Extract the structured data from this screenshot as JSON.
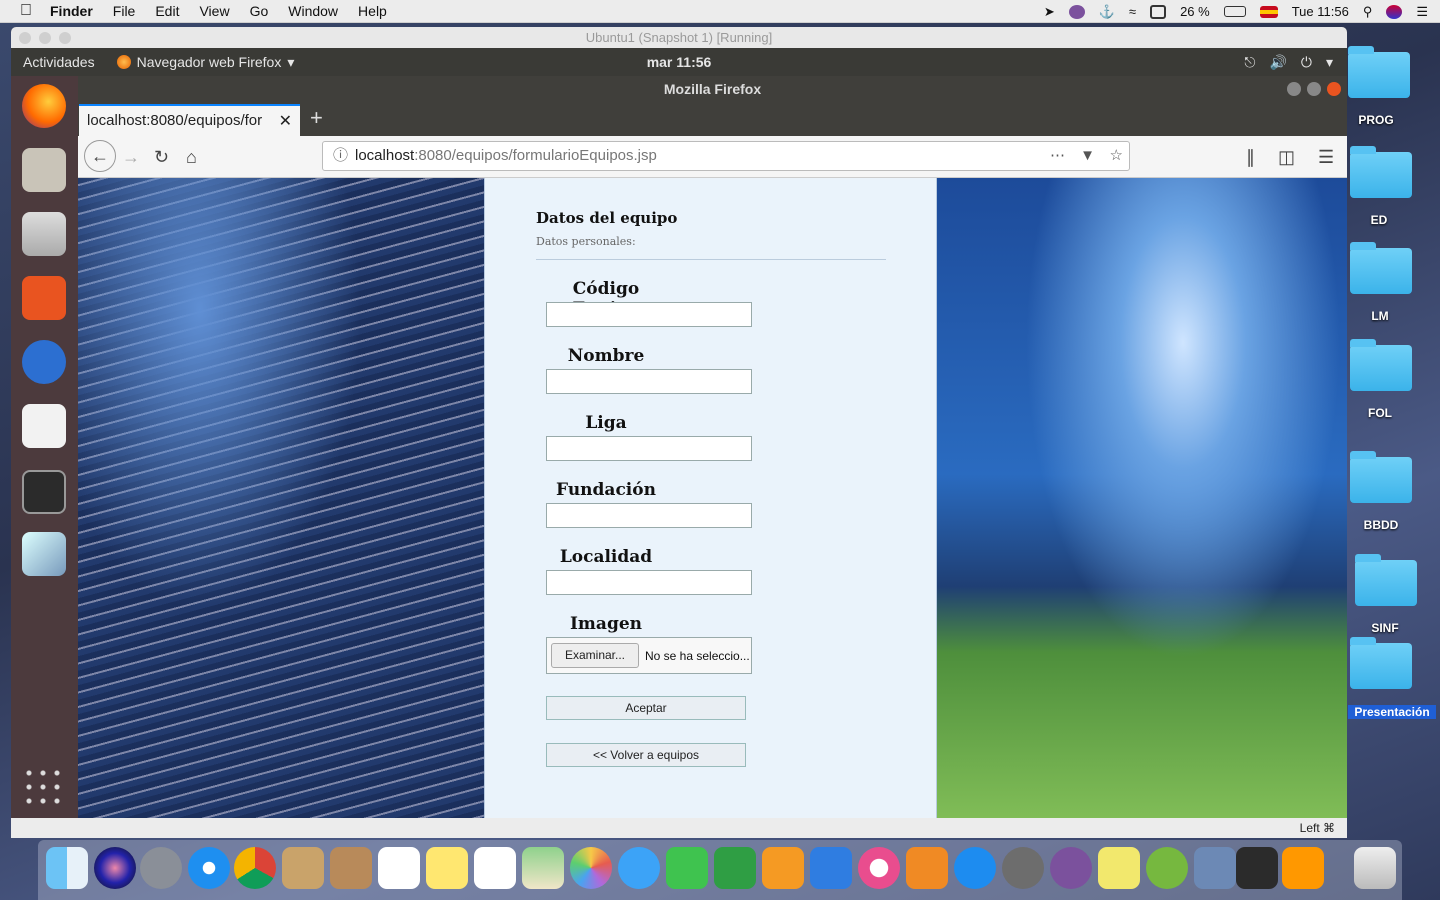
{
  "mac": {
    "menu": [
      "Finder",
      "File",
      "Edit",
      "View",
      "Go",
      "Window",
      "Help"
    ],
    "battery": "26 %",
    "clock": "Tue 11:56"
  },
  "desktop": {
    "folders": [
      "PROG",
      "ED",
      "LM",
      "FOL",
      "BBDD",
      "SINF",
      "Presentación"
    ]
  },
  "vm": {
    "title": "Ubuntu1 (Snapshot 1) [Running]",
    "status": "Left ⌘"
  },
  "ubuntu": {
    "activities": "Actividades",
    "app": "Navegador web Firefox",
    "clock": "mar 11:56"
  },
  "firefox": {
    "title": "Mozilla Firefox",
    "tab_label": "localhost:8080/equipos/for",
    "url_host": "localhost",
    "url_path": ":8080/equipos/formularioEquipos.jsp"
  },
  "form": {
    "title": "Datos del equipo",
    "subtitle": "Datos personales:",
    "fields": [
      "Código Equipo",
      "Nombre",
      "Liga",
      "Fundación",
      "Localidad",
      "Imagen"
    ],
    "browse": "Examinar...",
    "no_file": "No se ha seleccio...",
    "accept": "Aceptar",
    "back": "<< Volver a equipos"
  }
}
